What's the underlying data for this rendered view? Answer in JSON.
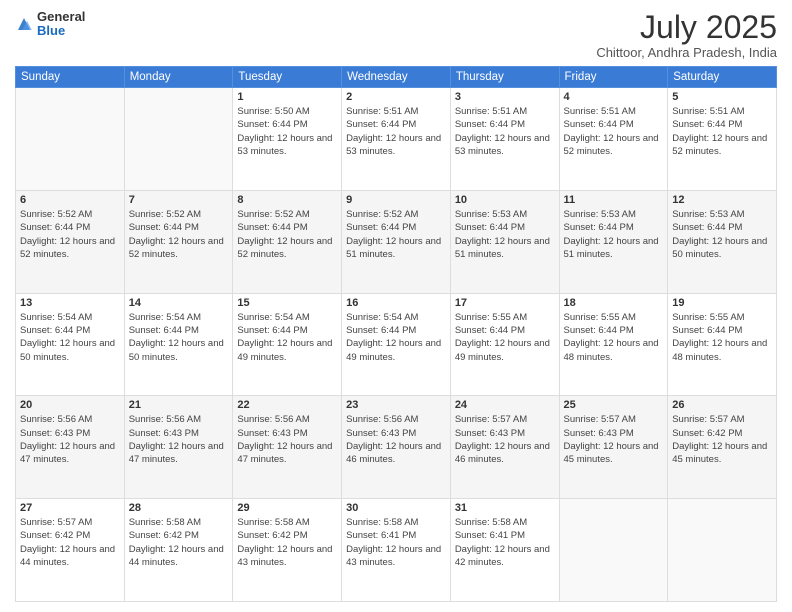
{
  "header": {
    "logo_general": "General",
    "logo_blue": "Blue",
    "month_title": "July 2025",
    "location": "Chittoor, Andhra Pradesh, India"
  },
  "weekdays": [
    "Sunday",
    "Monday",
    "Tuesday",
    "Wednesday",
    "Thursday",
    "Friday",
    "Saturday"
  ],
  "weeks": [
    [
      {
        "day": "",
        "sunrise": "",
        "sunset": "",
        "daylight": ""
      },
      {
        "day": "",
        "sunrise": "",
        "sunset": "",
        "daylight": ""
      },
      {
        "day": "1",
        "sunrise": "Sunrise: 5:50 AM",
        "sunset": "Sunset: 6:44 PM",
        "daylight": "Daylight: 12 hours and 53 minutes."
      },
      {
        "day": "2",
        "sunrise": "Sunrise: 5:51 AM",
        "sunset": "Sunset: 6:44 PM",
        "daylight": "Daylight: 12 hours and 53 minutes."
      },
      {
        "day": "3",
        "sunrise": "Sunrise: 5:51 AM",
        "sunset": "Sunset: 6:44 PM",
        "daylight": "Daylight: 12 hours and 53 minutes."
      },
      {
        "day": "4",
        "sunrise": "Sunrise: 5:51 AM",
        "sunset": "Sunset: 6:44 PM",
        "daylight": "Daylight: 12 hours and 52 minutes."
      },
      {
        "day": "5",
        "sunrise": "Sunrise: 5:51 AM",
        "sunset": "Sunset: 6:44 PM",
        "daylight": "Daylight: 12 hours and 52 minutes."
      }
    ],
    [
      {
        "day": "6",
        "sunrise": "Sunrise: 5:52 AM",
        "sunset": "Sunset: 6:44 PM",
        "daylight": "Daylight: 12 hours and 52 minutes."
      },
      {
        "day": "7",
        "sunrise": "Sunrise: 5:52 AM",
        "sunset": "Sunset: 6:44 PM",
        "daylight": "Daylight: 12 hours and 52 minutes."
      },
      {
        "day": "8",
        "sunrise": "Sunrise: 5:52 AM",
        "sunset": "Sunset: 6:44 PM",
        "daylight": "Daylight: 12 hours and 52 minutes."
      },
      {
        "day": "9",
        "sunrise": "Sunrise: 5:52 AM",
        "sunset": "Sunset: 6:44 PM",
        "daylight": "Daylight: 12 hours and 51 minutes."
      },
      {
        "day": "10",
        "sunrise": "Sunrise: 5:53 AM",
        "sunset": "Sunset: 6:44 PM",
        "daylight": "Daylight: 12 hours and 51 minutes."
      },
      {
        "day": "11",
        "sunrise": "Sunrise: 5:53 AM",
        "sunset": "Sunset: 6:44 PM",
        "daylight": "Daylight: 12 hours and 51 minutes."
      },
      {
        "day": "12",
        "sunrise": "Sunrise: 5:53 AM",
        "sunset": "Sunset: 6:44 PM",
        "daylight": "Daylight: 12 hours and 50 minutes."
      }
    ],
    [
      {
        "day": "13",
        "sunrise": "Sunrise: 5:54 AM",
        "sunset": "Sunset: 6:44 PM",
        "daylight": "Daylight: 12 hours and 50 minutes."
      },
      {
        "day": "14",
        "sunrise": "Sunrise: 5:54 AM",
        "sunset": "Sunset: 6:44 PM",
        "daylight": "Daylight: 12 hours and 50 minutes."
      },
      {
        "day": "15",
        "sunrise": "Sunrise: 5:54 AM",
        "sunset": "Sunset: 6:44 PM",
        "daylight": "Daylight: 12 hours and 49 minutes."
      },
      {
        "day": "16",
        "sunrise": "Sunrise: 5:54 AM",
        "sunset": "Sunset: 6:44 PM",
        "daylight": "Daylight: 12 hours and 49 minutes."
      },
      {
        "day": "17",
        "sunrise": "Sunrise: 5:55 AM",
        "sunset": "Sunset: 6:44 PM",
        "daylight": "Daylight: 12 hours and 49 minutes."
      },
      {
        "day": "18",
        "sunrise": "Sunrise: 5:55 AM",
        "sunset": "Sunset: 6:44 PM",
        "daylight": "Daylight: 12 hours and 48 minutes."
      },
      {
        "day": "19",
        "sunrise": "Sunrise: 5:55 AM",
        "sunset": "Sunset: 6:44 PM",
        "daylight": "Daylight: 12 hours and 48 minutes."
      }
    ],
    [
      {
        "day": "20",
        "sunrise": "Sunrise: 5:56 AM",
        "sunset": "Sunset: 6:43 PM",
        "daylight": "Daylight: 12 hours and 47 minutes."
      },
      {
        "day": "21",
        "sunrise": "Sunrise: 5:56 AM",
        "sunset": "Sunset: 6:43 PM",
        "daylight": "Daylight: 12 hours and 47 minutes."
      },
      {
        "day": "22",
        "sunrise": "Sunrise: 5:56 AM",
        "sunset": "Sunset: 6:43 PM",
        "daylight": "Daylight: 12 hours and 47 minutes."
      },
      {
        "day": "23",
        "sunrise": "Sunrise: 5:56 AM",
        "sunset": "Sunset: 6:43 PM",
        "daylight": "Daylight: 12 hours and 46 minutes."
      },
      {
        "day": "24",
        "sunrise": "Sunrise: 5:57 AM",
        "sunset": "Sunset: 6:43 PM",
        "daylight": "Daylight: 12 hours and 46 minutes."
      },
      {
        "day": "25",
        "sunrise": "Sunrise: 5:57 AM",
        "sunset": "Sunset: 6:43 PM",
        "daylight": "Daylight: 12 hours and 45 minutes."
      },
      {
        "day": "26",
        "sunrise": "Sunrise: 5:57 AM",
        "sunset": "Sunset: 6:42 PM",
        "daylight": "Daylight: 12 hours and 45 minutes."
      }
    ],
    [
      {
        "day": "27",
        "sunrise": "Sunrise: 5:57 AM",
        "sunset": "Sunset: 6:42 PM",
        "daylight": "Daylight: 12 hours and 44 minutes."
      },
      {
        "day": "28",
        "sunrise": "Sunrise: 5:58 AM",
        "sunset": "Sunset: 6:42 PM",
        "daylight": "Daylight: 12 hours and 44 minutes."
      },
      {
        "day": "29",
        "sunrise": "Sunrise: 5:58 AM",
        "sunset": "Sunset: 6:42 PM",
        "daylight": "Daylight: 12 hours and 43 minutes."
      },
      {
        "day": "30",
        "sunrise": "Sunrise: 5:58 AM",
        "sunset": "Sunset: 6:41 PM",
        "daylight": "Daylight: 12 hours and 43 minutes."
      },
      {
        "day": "31",
        "sunrise": "Sunrise: 5:58 AM",
        "sunset": "Sunset: 6:41 PM",
        "daylight": "Daylight: 12 hours and 42 minutes."
      },
      {
        "day": "",
        "sunrise": "",
        "sunset": "",
        "daylight": ""
      },
      {
        "day": "",
        "sunrise": "",
        "sunset": "",
        "daylight": ""
      }
    ]
  ]
}
